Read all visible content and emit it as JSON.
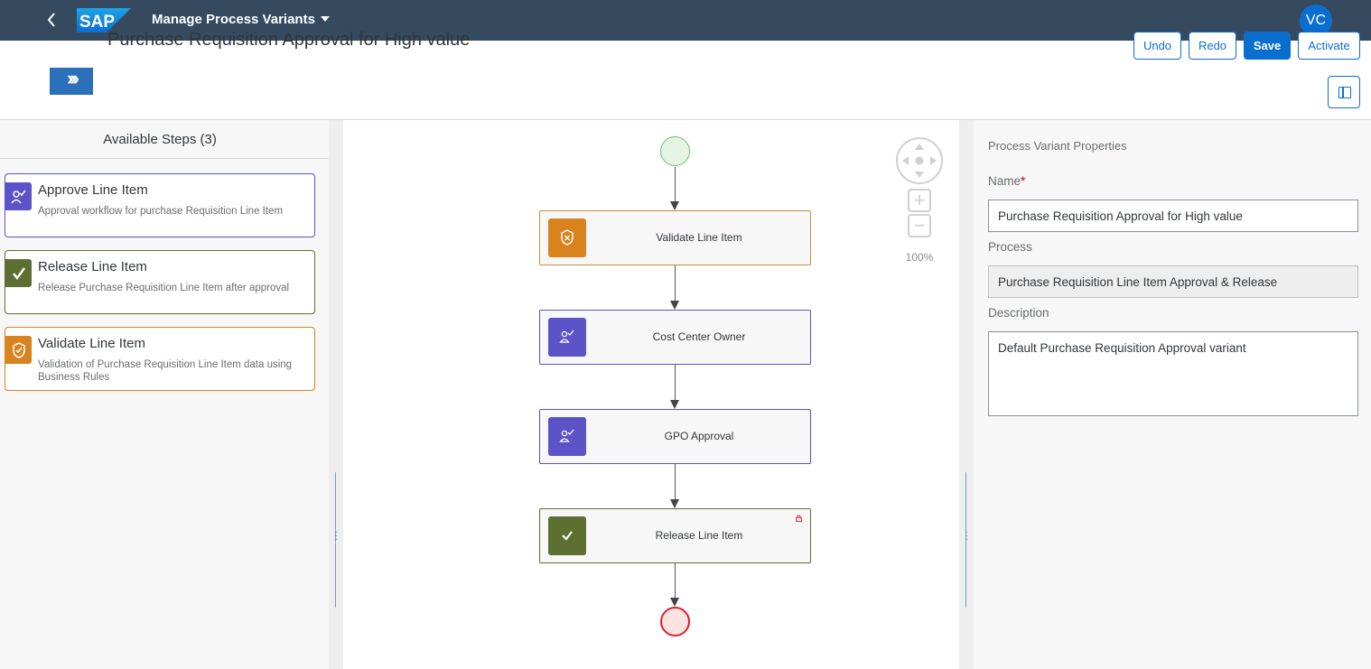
{
  "shell": {
    "logo_text": "SAP",
    "app_title": "Manage Process Variants",
    "avatar_initials": "VC"
  },
  "header": {
    "object_title": "Purchase Requisition Approval for High value",
    "undo_label": "Undo",
    "redo_label": "Redo",
    "save_label": "Save",
    "activate_label": "Activate"
  },
  "available_steps": {
    "title": "Available Steps (3)",
    "items": [
      {
        "title": "Approve Line Item",
        "description": "Approval workflow for purchase Requisition Line Item",
        "icon": "user-check-icon",
        "color": "#5b53c7"
      },
      {
        "title": "Release Line Item",
        "description": "Release Purchase Requisition Line Item after approval",
        "icon": "checkmark-icon",
        "color": "#5d7032"
      },
      {
        "title": "Validate Line Item",
        "description": "Validation of Purchase Requisition Line Item data using Business Rules",
        "icon": "shield-check-icon",
        "color": "#d9831f"
      }
    ]
  },
  "flow": {
    "nodes": [
      {
        "label": "Validate Line Item",
        "icon": "shield-check-icon",
        "color": "#d9831f"
      },
      {
        "label": "Cost Center Owner",
        "icon": "user-check-icon",
        "color": "#5b53c7"
      },
      {
        "label": "GPO Approval",
        "icon": "user-check-icon",
        "color": "#5b53c7"
      },
      {
        "label": "Release Line Item",
        "icon": "checkmark-icon",
        "color": "#5d7032",
        "locked": true
      }
    ],
    "zoom_level": "100%"
  },
  "properties": {
    "title": "Process Variant Properties",
    "name_label": "Name",
    "name_required_mark": "*",
    "name_value": "Purchase Requisition Approval for High value",
    "process_label": "Process",
    "process_value": "Purchase Requisition Line Item Approval & Release",
    "description_label": "Description",
    "description_value": "Default Purchase Requisition Approval variant"
  },
  "colors": {
    "shell_bg": "#354a5f",
    "accent": "#0a6ed1",
    "orange": "#d9831f",
    "purple": "#5b53c7",
    "green": "#5d7032"
  }
}
